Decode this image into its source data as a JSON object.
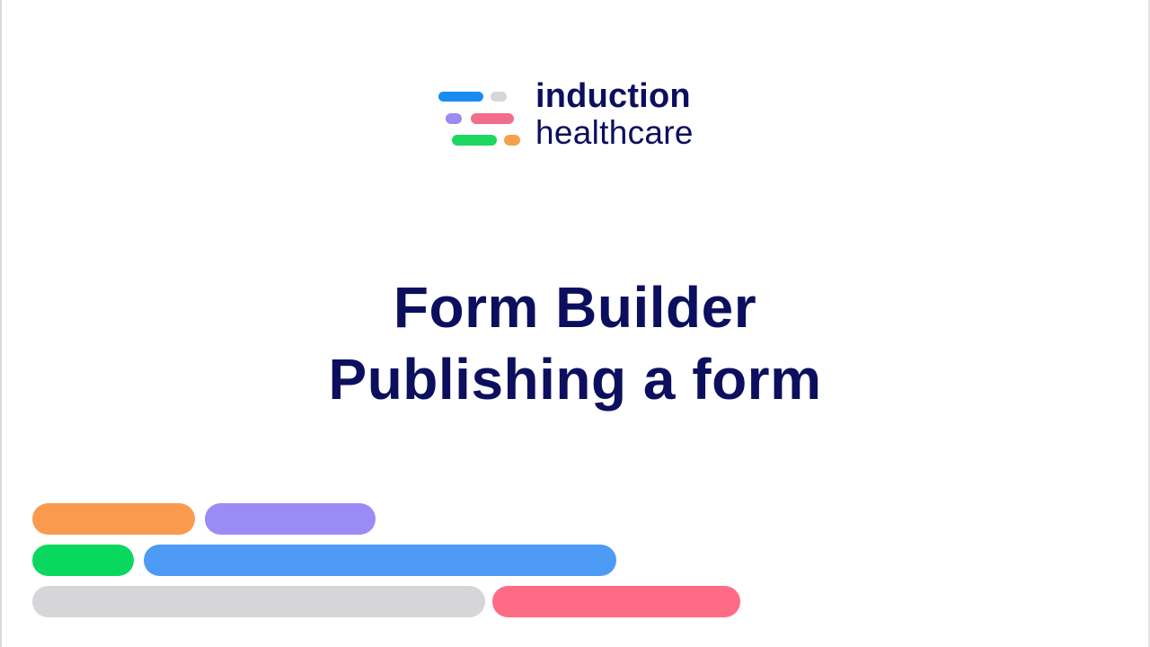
{
  "logo": {
    "line1": "induction",
    "line2": "healthcare",
    "mark_colors": {
      "blue": "#1a8cf0",
      "grey": "#d6d6d8",
      "purple": "#9a8af3",
      "pink": "#f26d8a",
      "green": "#1ed760",
      "orange": "#f5a24a"
    }
  },
  "title": {
    "line1": "Form Builder",
    "line2": "Publishing a form"
  },
  "colors": {
    "text": "#0c0f5e",
    "background": "#ffffff",
    "orange": "#f99a4f",
    "purple": "#9b8bf7",
    "green": "#08d85e",
    "blue": "#4e9bf5",
    "grey": "#d6d6d8",
    "pink": "#fd6b85"
  }
}
